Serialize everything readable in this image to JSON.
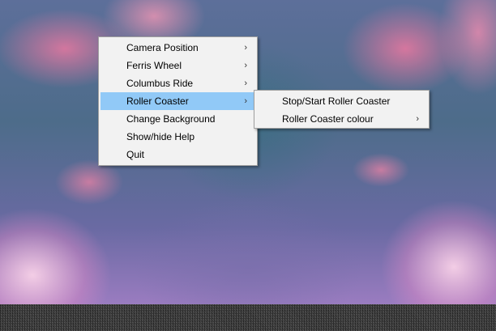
{
  "main_menu": {
    "items": [
      {
        "label": "Camera Position",
        "submenu_arrow": "›"
      },
      {
        "label": "Ferris Wheel",
        "submenu_arrow": "›"
      },
      {
        "label": "Columbus Ride",
        "submenu_arrow": "›"
      },
      {
        "label": "Roller Coaster",
        "submenu_arrow": "›",
        "highlighted": true
      },
      {
        "label": "Change Background"
      },
      {
        "label": "Show/hide Help"
      },
      {
        "label": "Quit"
      }
    ]
  },
  "roller_coaster_submenu": {
    "items": [
      {
        "label": "Stop/Start Roller Coaster"
      },
      {
        "label": "Roller Coaster colour",
        "submenu_arrow": "›"
      }
    ]
  },
  "colors": {
    "menu_background": "#f2f2f2",
    "highlight": "#91c9f7"
  }
}
